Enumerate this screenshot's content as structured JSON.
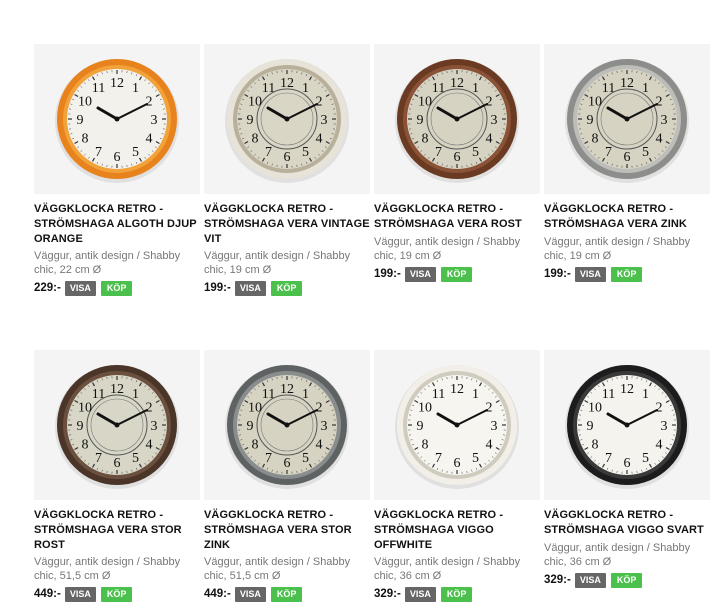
{
  "products": [
    {
      "title": "VÄGGKLOCKA RETRO - STRÖMSHAGA ALGOTH DJUP ORANGE",
      "desc": "Väggur, antik design / Shabby chic, 22 cm Ø",
      "price": "229:-",
      "pay": "VISA",
      "buy": "KÖP",
      "frame": "#e8821c",
      "frame2": "#f2a23a",
      "face": "#f3f1ec",
      "style": "modern"
    },
    {
      "title": "VÄGGKLOCKA RETRO - STRÖMSHAGA VERA VINTAGE VIT",
      "desc": "Väggur, antik design / Shabby chic, 19 cm Ø",
      "price": "199:-",
      "pay": "VISA",
      "buy": "KÖP",
      "frame": "#e7e3d8",
      "frame2": "#b8b09a",
      "face": "#d9d6c6",
      "style": "vintage"
    },
    {
      "title": "VÄGGKLOCKA RETRO - STRÖMSHAGA VERA ROST",
      "desc": "Väggur, antik design / Shabby chic, 19 cm Ø",
      "price": "199:-",
      "pay": "VISA",
      "buy": "KÖP",
      "frame": "#6a3a22",
      "frame2": "#8a5236",
      "face": "#d7d3c3",
      "style": "vintage"
    },
    {
      "title": "VÄGGKLOCKA RETRO - STRÖMSHAGA VERA ZINK",
      "desc": "Väggur, antik design / Shabby chic, 19 cm Ø",
      "price": "199:-",
      "pay": "VISA",
      "buy": "KÖP",
      "frame": "#8d8d8b",
      "frame2": "#bdbdb9",
      "face": "#d6d3c3",
      "style": "vintage"
    },
    {
      "title": "VÄGGKLOCKA RETRO - STRÖMSHAGA VERA STOR ROST",
      "desc": "Väggur, antik design / Shabby chic, 51,5 cm Ø",
      "price": "449:-",
      "pay": "VISA",
      "buy": "KÖP",
      "frame": "#4a3528",
      "frame2": "#6b5040",
      "face": "#d8d6c6",
      "style": "vintage"
    },
    {
      "title": "VÄGGKLOCKA RETRO - STRÖMSHAGA VERA STOR ZINK",
      "desc": "Väggur, antik design / Shabby chic, 51,5 cm Ø",
      "price": "449:-",
      "pay": "VISA",
      "buy": "KÖP",
      "frame": "#5f6262",
      "frame2": "#8a8d8d",
      "face": "#d6d3c2",
      "style": "vintage"
    },
    {
      "title": "VÄGGKLOCKA RETRO - STRÖMSHAGA VIGGO OFFWHITE",
      "desc": "Väggur, antik design / Shabby chic, 36 cm Ø",
      "price": "329:-",
      "pay": "VISA",
      "buy": "KÖP",
      "frame": "#f1efe8",
      "frame2": "#cfcbbf",
      "face": "#f6f5f0",
      "style": "modern"
    },
    {
      "title": "VÄGGKLOCKA RETRO - STRÖMSHAGA VIGGO SVART",
      "desc": "Väggur, antik design / Shabby chic, 36 cm Ø",
      "price": "329:-",
      "pay": "VISA",
      "buy": "KÖP",
      "frame": "#1c1c1c",
      "frame2": "#3a3a3a",
      "face": "#f4f3ee",
      "style": "modern"
    }
  ]
}
